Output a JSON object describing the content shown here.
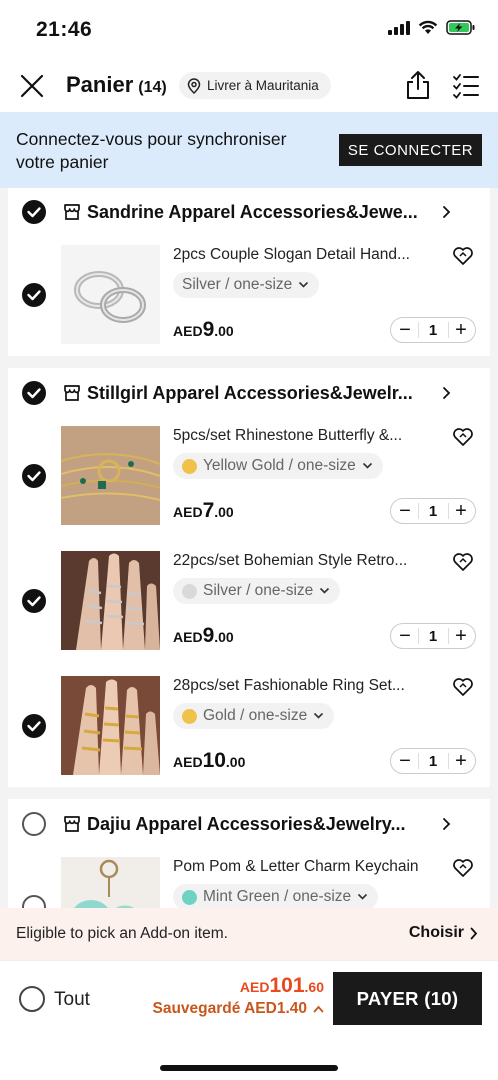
{
  "status_bar": {
    "time": "21:46"
  },
  "header": {
    "title": "Panier",
    "count": "(14)",
    "ship_label": "Livrer à Mauritania"
  },
  "login_banner": {
    "text": "Connectez-vous pour synchroniser votre panier",
    "button_label": "SE CONNECTER"
  },
  "stores": [
    {
      "name": "Sandrine Apparel Accessories&Jewe...",
      "checked": true,
      "items": [
        {
          "title": "2pcs Couple Slogan Detail Hand...",
          "variant": "Silver / one-size",
          "swatch": "",
          "price_currency": "AED",
          "price_int": "9",
          "price_dec": ".00",
          "qty": "1",
          "checked": true
        }
      ]
    },
    {
      "name": "Stillgirl Apparel Accessories&Jewelr...",
      "checked": true,
      "items": [
        {
          "title": "5pcs/set Rhinestone Butterfly &...",
          "variant": "Yellow Gold / one-size",
          "swatch": "#f0c24b",
          "price_currency": "AED",
          "price_int": "7",
          "price_dec": ".00",
          "qty": "1",
          "checked": true
        },
        {
          "title": "22pcs/set Bohemian Style Retro...",
          "variant": "Silver / one-size",
          "swatch": "#d9d9d9",
          "price_currency": "AED",
          "price_int": "9",
          "price_dec": ".00",
          "qty": "1",
          "checked": true
        },
        {
          "title": "28pcs/set Fashionable Ring Set...",
          "variant": "Gold / one-size",
          "swatch": "#f0c24b",
          "price_currency": "AED",
          "price_int": "10",
          "price_dec": ".00",
          "qty": "1",
          "checked": true
        }
      ]
    },
    {
      "name": "Dajiu Apparel Accessories&Jewelry...",
      "checked": false,
      "items": [
        {
          "title": "Pom Pom & Letter Charm Keychain",
          "variant": "Mint Green / one-size",
          "swatch": "#6fd3c4",
          "checked": false
        }
      ]
    }
  ],
  "addon_bar": {
    "text": "Eligible to pick an Add-on item.",
    "link": "Choisir"
  },
  "checkout": {
    "all_label": "Tout",
    "total_currency": "AED",
    "total_int": "101",
    "total_dec": ".60",
    "saved_label": "Sauvegardé AED1.40",
    "pay_label": "PAYER (10)"
  },
  "colors": {
    "accent_orange": "#e8491d",
    "banner_blue": "#dcebfb",
    "button_dark": "#1a1a1a"
  }
}
